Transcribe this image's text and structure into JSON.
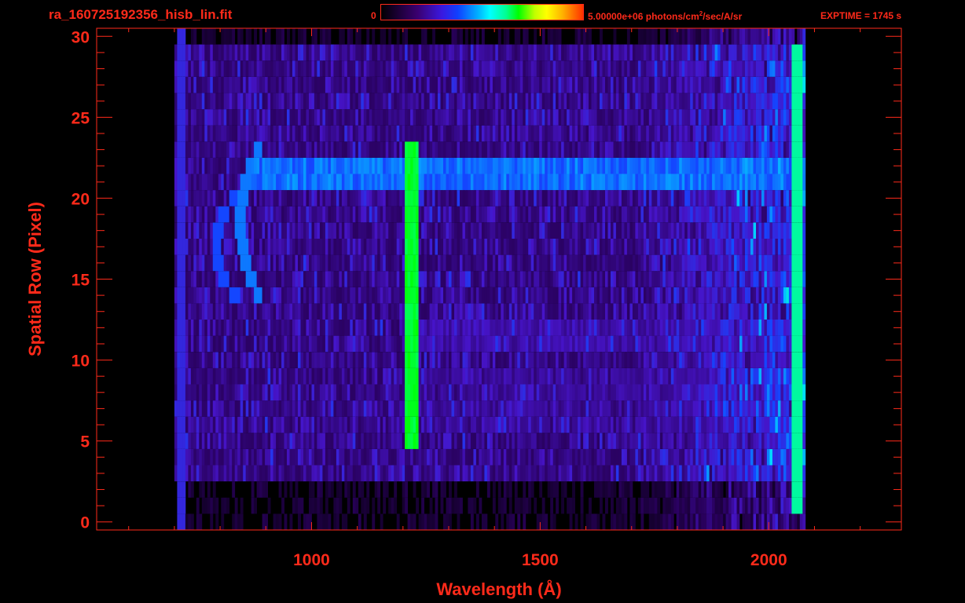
{
  "header": {
    "file_title": "ra_160725192356_hisb_lin.fit",
    "colorbar_min": "0",
    "colorbar_max_prefix": "5.00000e+06 photons/cm",
    "colorbar_max_exp": "2",
    "colorbar_max_suffix": "/sec/A/sr",
    "exptime": "EXPTIME = 1745 s"
  },
  "colors": {
    "foreground": "#ff2a1a",
    "background": "#000000",
    "colormap": [
      "#000000",
      "#3a0070",
      "#1040ff",
      "#00ffff",
      "#00ff00",
      "#ffff00",
      "#ff3000"
    ]
  },
  "chart_data": {
    "type": "heatmap",
    "xlabel": "Wavelength (Å)",
    "ylabel": "Spatial Row (Pixel)",
    "xlim": [
      530,
      2290
    ],
    "ylim": [
      -0.5,
      30.5
    ],
    "x_tick_labels": [
      "1000",
      "1500",
      "2000"
    ],
    "x_ticks": [
      1000,
      1500,
      2000
    ],
    "y_tick_labels": [
      "0",
      "5",
      "10",
      "15",
      "20",
      "25",
      "30"
    ],
    "y_ticks": [
      0,
      5,
      10,
      15,
      20,
      25,
      30
    ],
    "color_scale": {
      "min": 0,
      "max": 5000000,
      "units": "photons/cm^2/sec/A/sr"
    },
    "data_extent": {
      "wavelength": [
        700,
        2080
      ],
      "rows": [
        0,
        30
      ]
    },
    "features": [
      {
        "kind": "emission_line",
        "wavelength": 1216,
        "rows": [
          5,
          23
        ],
        "level": 0.72
      },
      {
        "kind": "bright_band",
        "rows": [
          21,
          22
        ],
        "wavelength": [
          860,
          2080
        ],
        "level": 0.45
      },
      {
        "kind": "bright_band",
        "rows": [
          11,
          12
        ],
        "wavelength": [
          1200,
          2080
        ],
        "level": 0.25
      },
      {
        "kind": "bright_band",
        "rows": [
          6,
          9
        ],
        "wavelength": [
          1180,
          2080
        ],
        "level": 0.22
      },
      {
        "kind": "arc",
        "rows": [
          14,
          23
        ],
        "wavelength_center": 880,
        "level": 0.42
      },
      {
        "kind": "arc",
        "rows": [
          14,
          20
        ],
        "wavelength_center": 830,
        "level": 0.38
      },
      {
        "kind": "edge_band",
        "wavelength": [
          2050,
          2070
        ],
        "rows": [
          1,
          29
        ],
        "level": 0.6
      }
    ]
  }
}
